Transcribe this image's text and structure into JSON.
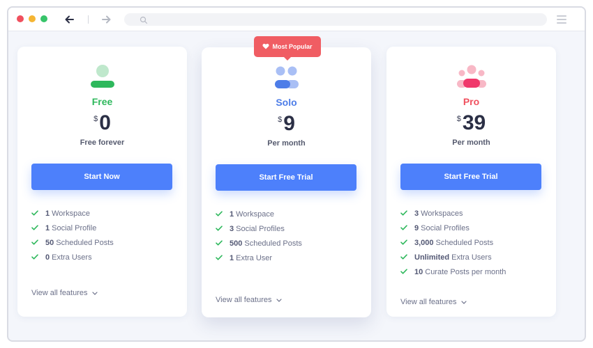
{
  "browser": {
    "icons": {
      "back": "arrow-left-icon",
      "forward": "arrow-right-icon",
      "search": "search-icon",
      "menu": "hamburger-menu-icon"
    }
  },
  "colors": {
    "accent": "#4d80fb",
    "free": "#2eb85c",
    "solo": "#4d7de8",
    "pro": "#f0505e",
    "badge": "#f05d63"
  },
  "badge": {
    "label": "Most Popular",
    "icon": "heart-icon"
  },
  "plans": [
    {
      "name": "Free",
      "currency": "$",
      "price": "0",
      "period": "Free forever",
      "cta": "Start Now",
      "icon": "single-user-icon",
      "features": [
        {
          "value": "1",
          "label": "Workspace"
        },
        {
          "value": "1",
          "label": "Social Profile"
        },
        {
          "value": "50",
          "label": "Scheduled Posts"
        },
        {
          "value": "0",
          "label": "Extra Users"
        }
      ],
      "view_all": "View all features"
    },
    {
      "name": "Solo",
      "currency": "$",
      "price": "9",
      "period": "Per month",
      "cta": "Start Free Trial",
      "icon": "two-users-icon",
      "features": [
        {
          "value": "1",
          "label": "Workspace"
        },
        {
          "value": "3",
          "label": "Social Profiles"
        },
        {
          "value": "500",
          "label": "Scheduled Posts"
        },
        {
          "value": "1",
          "label": "Extra User"
        }
      ],
      "view_all": "View all features"
    },
    {
      "name": "Pro",
      "currency": "$",
      "price": "39",
      "period": "Per month",
      "cta": "Start Free Trial",
      "icon": "team-users-icon",
      "features": [
        {
          "value": "3",
          "label": "Workspaces"
        },
        {
          "value": "9",
          "label": "Social Profiles"
        },
        {
          "value": "3,000",
          "label": "Scheduled Posts"
        },
        {
          "value": "Unlimited",
          "label": "Extra Users"
        },
        {
          "value": "10",
          "label": "Curate Posts per month"
        }
      ],
      "view_all": "View all features"
    }
  ]
}
